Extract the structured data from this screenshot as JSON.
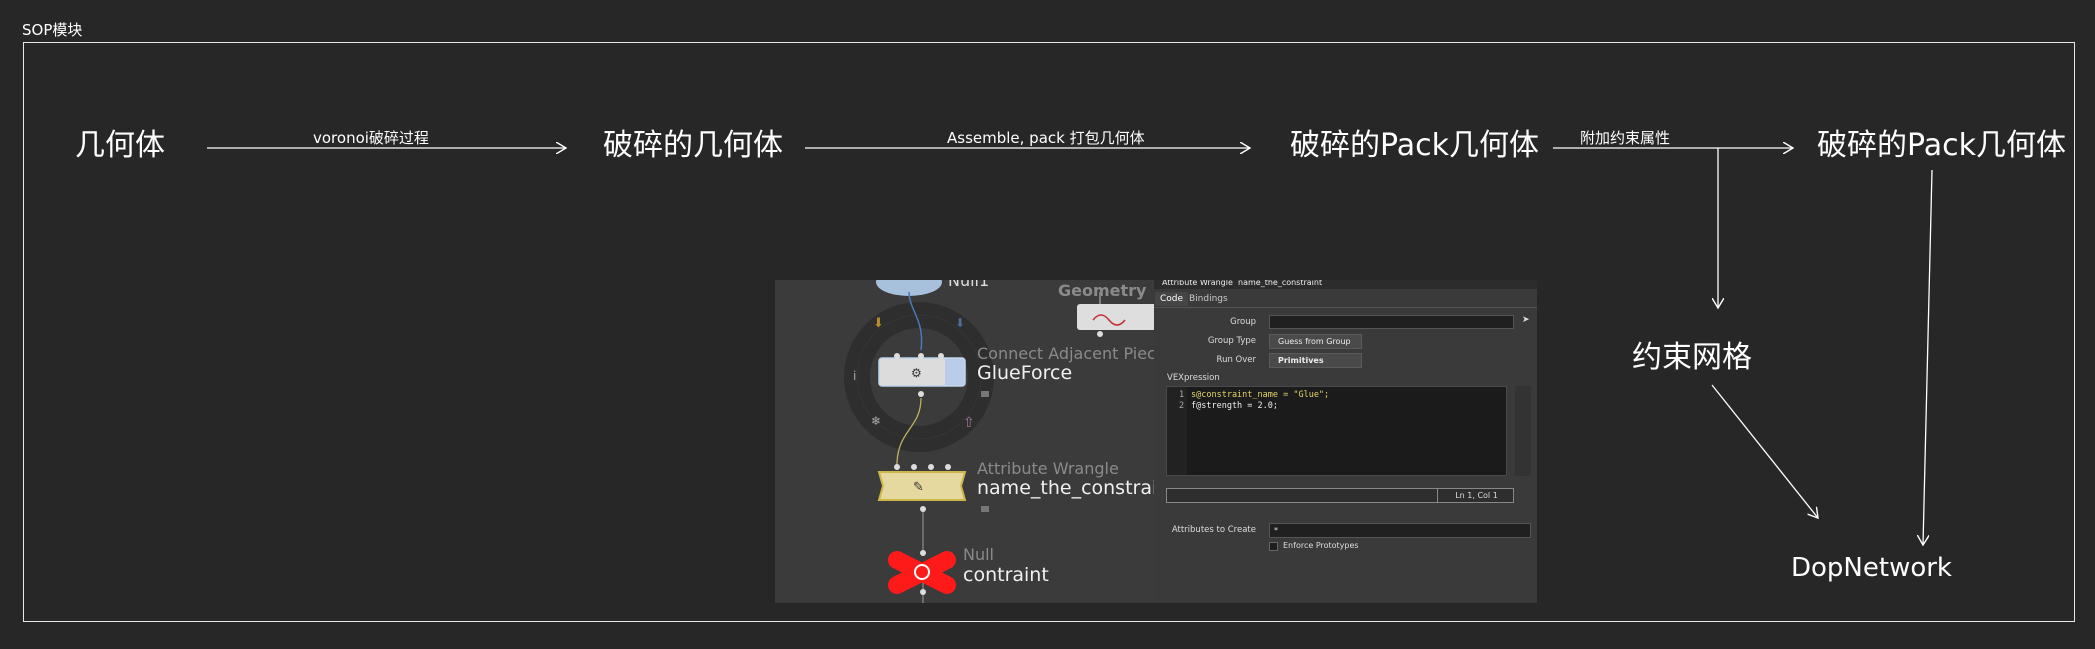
{
  "frame": {
    "label": "SOP模块"
  },
  "nodes": {
    "geometry": "几何体",
    "fractured": "破碎的几何体",
    "fractured_pack": "破碎的Pack几何体",
    "fractured_pack2": "破碎的Pack几何体",
    "constraint_mesh": "约束网格",
    "dopnetwork": "DopNetwork"
  },
  "edges": {
    "voronoi": "voronoi破碎过程",
    "assemble": "Assemble, pack 打包几何体",
    "attach": "附加约束属性"
  },
  "screenshot": {
    "network": {
      "top_node": "Null1",
      "geometry": "Geometry",
      "glue_type": "Connect Adjacent Pieces",
      "glue_name": "GlueForce",
      "wrangle_type": "Attribute Wrangle",
      "wrangle_name": "name_the_constraint",
      "null_type": "Null",
      "null_name": "contraint"
    },
    "params": {
      "title_type": "Attribute Wrangle",
      "title_name": "name_the_constraint",
      "tab_code": "Code",
      "tab_bindings": "Bindings",
      "group_label": "Group",
      "group_type_label": "Group Type",
      "group_type_value": "Guess from Group",
      "run_over_label": "Run Over",
      "run_over_value": "Primitives",
      "vex_label": "VEXpression",
      "code_line1": "s@constraint_name = \"Glue\";",
      "code_line2": "f@strength = 2.0;",
      "line_no_1": "1",
      "line_no_2": "2",
      "cursor_pos": "Ln 1, Col 1",
      "attrs_label": "Attributes to Create",
      "attrs_value": "*",
      "enforce_label": "Enforce Prototypes"
    }
  }
}
